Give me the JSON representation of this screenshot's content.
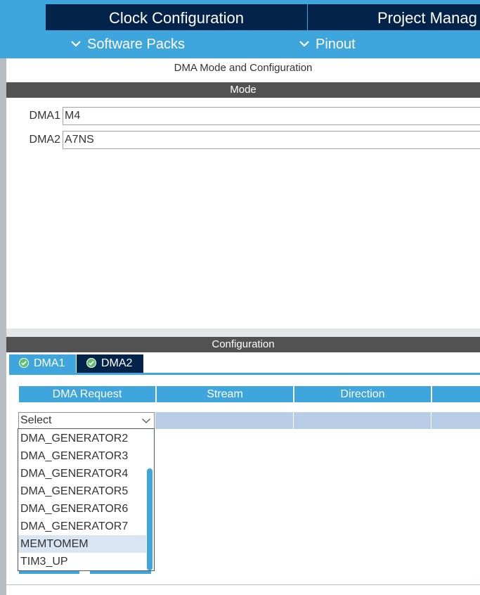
{
  "top_tabs": [
    "Clock Configuration",
    "Project Manag"
  ],
  "sub_menus": [
    "Software Packs",
    "Pinout"
  ],
  "panel_title": "DMA Mode and Configuration",
  "mode": {
    "header": "Mode",
    "rows": [
      {
        "label": "DMA1",
        "value": "M4"
      },
      {
        "label": "DMA2",
        "value": "A7NS"
      }
    ]
  },
  "configuration": {
    "header": "Configuration",
    "tabs": [
      "DMA1",
      "DMA2"
    ],
    "columns": [
      "DMA Request",
      "Stream",
      "Direction",
      ""
    ],
    "select_value": "Select",
    "dropdown_items": [
      "DMA_GENERATOR2",
      "DMA_GENERATOR3",
      "DMA_GENERATOR4",
      "DMA_GENERATOR5",
      "DMA_GENERATOR6",
      "DMA_GENERATOR7",
      "MEMTOMEM",
      "TIM3_UP"
    ],
    "highlighted_item": "MEMTOMEM"
  },
  "colors": {
    "accent_blue": "#3ea6dc",
    "navy": "#03234b",
    "header_gray": "#525252",
    "row_blue": "#b9cee6",
    "highlight": "#d9e5f2"
  }
}
